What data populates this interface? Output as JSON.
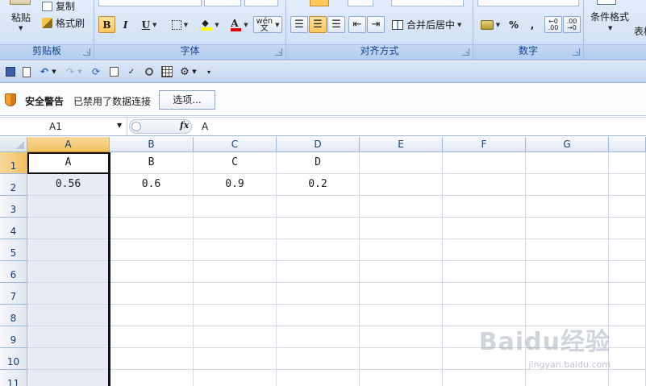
{
  "ribbon": {
    "clipboard": {
      "label": "剪贴板",
      "paste": "粘贴",
      "copy": "复制",
      "format_painter": "格式刷"
    },
    "font": {
      "label": "字体"
    },
    "alignment": {
      "label": "对齐方式",
      "merge_center": "合并后居中"
    },
    "number": {
      "label": "数字",
      "percent": "%",
      "comma": ","
    },
    "styles": {
      "conditional_format": "条件格式",
      "table_partial": "表格"
    }
  },
  "security": {
    "title": "安全警告",
    "message": "已禁用了数据连接",
    "options_button": "选项..."
  },
  "formula_bar": {
    "name_box": "A1",
    "fx": "fx",
    "content": "A"
  },
  "columns": [
    "A",
    "B",
    "C",
    "D",
    "E",
    "F",
    "G"
  ],
  "rows": [
    "1",
    "2",
    "3",
    "4",
    "5",
    "6",
    "7",
    "8",
    "9",
    "10",
    "11"
  ],
  "cells": {
    "r1": [
      "A",
      "B",
      "C",
      "D"
    ],
    "r2": [
      "0.56",
      "0.6",
      "0.9",
      "0.2"
    ]
  },
  "watermark": {
    "main": "Baidu经验",
    "sub": "jingyan.baidu.com"
  },
  "colors": {
    "ribbon_text": "#15428b",
    "selection_header": "#f1c15f",
    "font_color_bar": "#e00000",
    "highlight_bar": "#ffff00"
  }
}
